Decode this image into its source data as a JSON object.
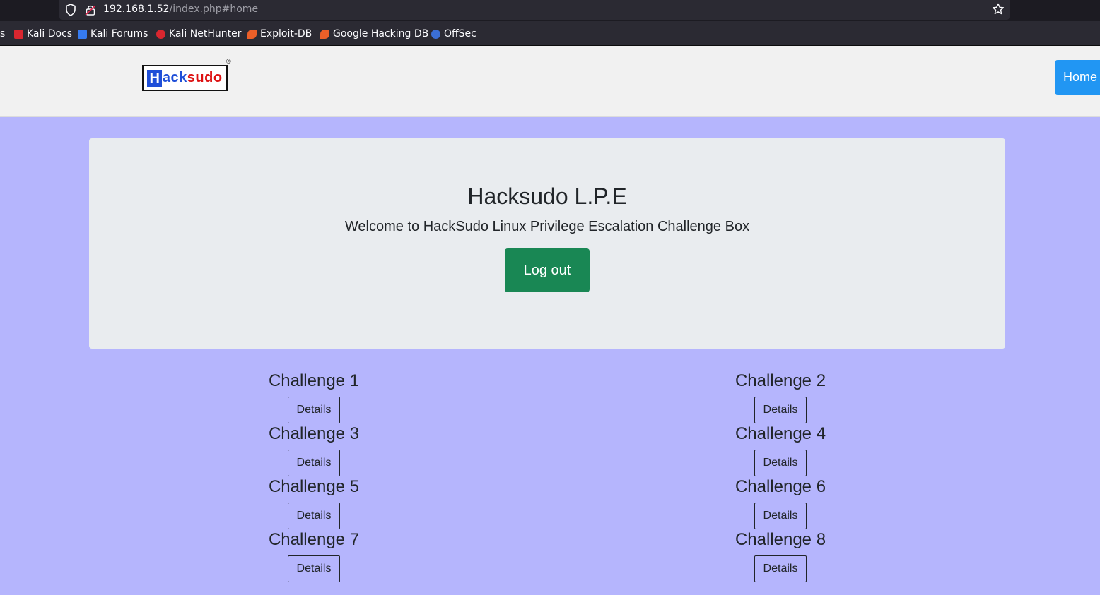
{
  "browser": {
    "url_host": "192.168.1.52",
    "url_path": "/index.php#home",
    "bookmarks": [
      {
        "label": "s",
        "icon": "truncated-bookmark",
        "color": "#2b2a33"
      },
      {
        "label": "Kali Docs",
        "icon": "kali-docs-icon",
        "color": "#d9262f"
      },
      {
        "label": "Kali Forums",
        "icon": "kali-forums-icon",
        "color": "#367bf0"
      },
      {
        "label": "Kali NetHunter",
        "icon": "kali-nethunter-icon",
        "color": "#d9262f"
      },
      {
        "label": "Exploit-DB",
        "icon": "exploit-db-icon",
        "color": "#ec5f28"
      },
      {
        "label": "Google Hacking DB",
        "icon": "ghdb-icon",
        "color": "#ec5f28"
      },
      {
        "label": "OffSec",
        "icon": "offsec-icon",
        "color": "#3b6fd6"
      }
    ]
  },
  "header": {
    "logo_h": "H",
    "logo_ack": "ack",
    "logo_sudo": "sudo",
    "logo_reg": "®",
    "home_label": "Home",
    "home_color": "#2196f3"
  },
  "jumbotron": {
    "title": "Hacksudo L.P.E",
    "subtitle": "Welcome to HackSudo Linux Privilege Escalation Challenge Box",
    "logout_label": "Log out",
    "logout_color": "#198754"
  },
  "challenges": [
    {
      "title": "Challenge 1",
      "button": "Details"
    },
    {
      "title": "Challenge 2",
      "button": "Details"
    },
    {
      "title": "Challenge 3",
      "button": "Details"
    },
    {
      "title": "Challenge 4",
      "button": "Details"
    },
    {
      "title": "Challenge 5",
      "button": "Details"
    },
    {
      "title": "Challenge 6",
      "button": "Details"
    },
    {
      "title": "Challenge 7",
      "button": "Details"
    },
    {
      "title": "Challenge 8",
      "button": "Details"
    }
  ],
  "colors": {
    "page_background": "#b5b5fd",
    "header_background": "#f1f1f1",
    "jumbotron_background": "#e9ecef"
  }
}
